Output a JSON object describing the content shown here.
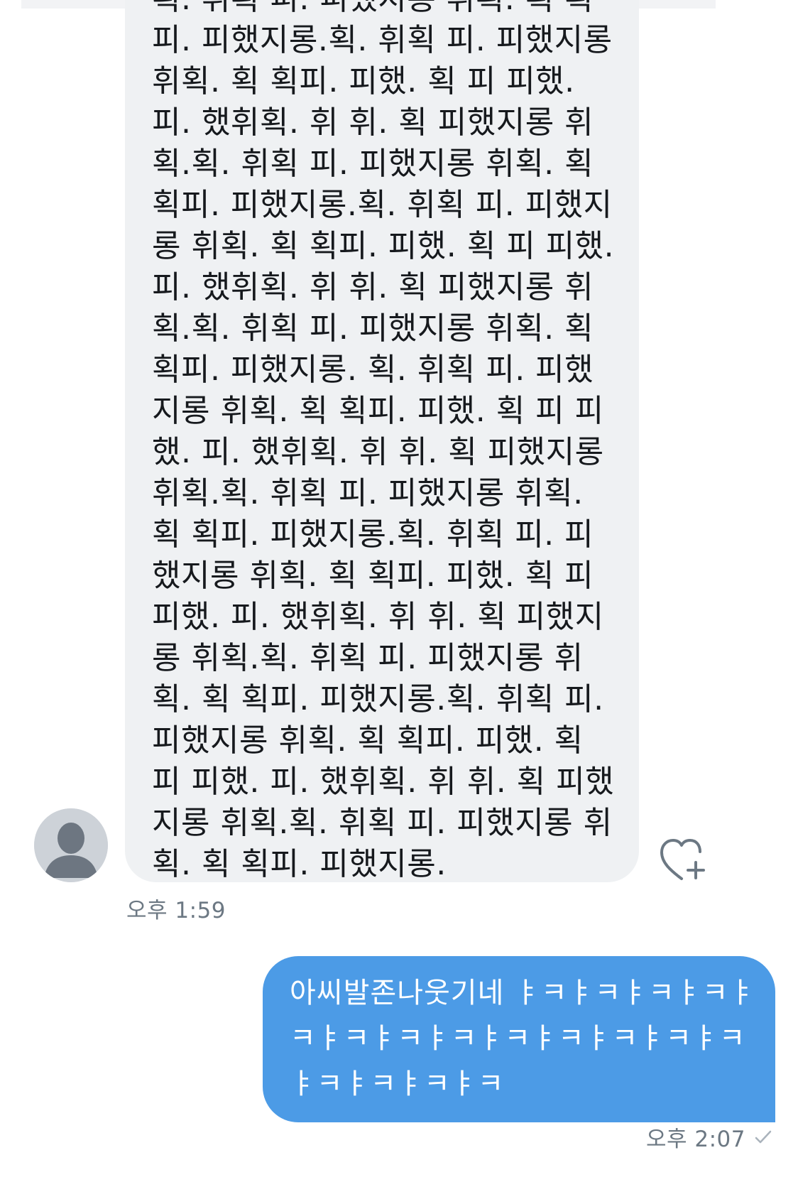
{
  "conversation": {
    "incoming_message": {
      "text": "획. 휘획 피. 피했지롱 휘획. 획 획피. 피했지롱.획. 휘획 피. 피했지롱 휘획. 획 획피. 피했. 획 피 피했. 피. 했휘획. 휘 휘. 획 피했지롱 휘획.획. 휘획 피. 피했지롱 휘획. 획 획피. 피했지롱.획. 휘획 피. 피했지롱 휘획. 획 획피. 피했. 획 피 피했. 피. 했휘획. 휘 휘. 획 피했지롱 휘획.획. 휘획 피. 피했지롱 휘획. 획 획피. 피했지롱. 획. 휘획 피. 피했지롱 휘획. 획 획피. 피했. 획 피 피했. 피. 했휘획. 휘 휘. 획 피했지롱 휘획.획. 휘획 피. 피했지롱 휘획. 획 획피. 피했지롱.획. 휘획 피. 피했지롱 휘획. 획 획피. 피했. 획 피 피했. 피. 했휘획. 휘 휘. 획 피했지롱 휘획.획. 휘획 피. 피했지롱 휘획. 획 획피. 피했지롱.획. 휘획 피. 피했지롱 휘획. 획 획피. 피했. 획 피 피했. 피. 했휘획. 휘 휘. 획 피했지롱 휘획.획. 휘획 피. 피했지롱 휘획. 획 획피. 피했지롱.",
      "time": "오후 1:59"
    },
    "outgoing_message": {
      "text": "아씨발존나웃기네 ㅑㅋㅑㅋㅑㅋㅑㅋㅑㅋㅑㅋㅑㅋㅑㅋㅑㅋㅑㅋㅑㅋㅑㅋㅑㅋㅑㅋㅑㅋㅑㅋㅑㅋ",
      "time": "오후 2:07"
    },
    "icons": {
      "avatar": "default-user-avatar-icon",
      "like": "heart-plus-icon",
      "read_status": "check-icon"
    },
    "colors": {
      "incoming_bubble": "#eff1f3",
      "outgoing_bubble": "#4c9be6",
      "timestamp": "#6c7883"
    }
  }
}
